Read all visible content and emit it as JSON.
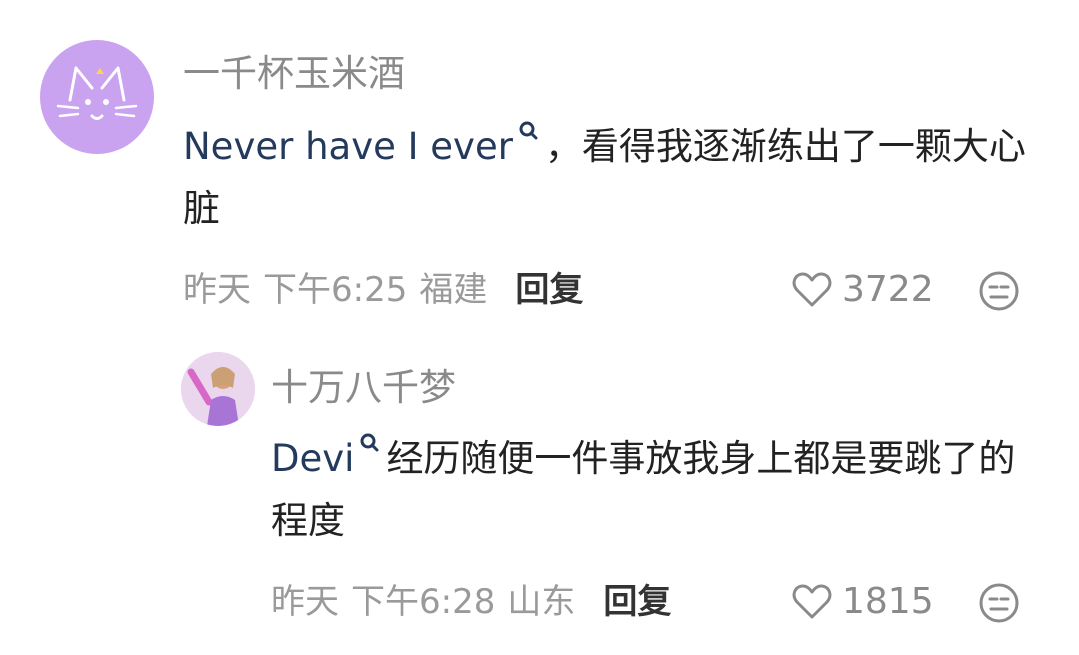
{
  "comments": [
    {
      "username": "一千杯玉米酒",
      "link_text": "Never have I ever",
      "body_after_link": "，看得我逐渐练出了一颗大心脏",
      "date": "昨天",
      "time": "下午6:25",
      "location": "福建",
      "reply_label": "回复",
      "likes": "3722",
      "avatar_color": "#c9a2f0",
      "link_color": "#243a5c"
    },
    {
      "username": "十万八千梦",
      "link_text": "Devi",
      "body_after_link": "经历随便一件事放我身上都是要跳了的程度",
      "date": "昨天",
      "time": "下午6:28",
      "location": "山东",
      "reply_label": "回复",
      "likes": "1815",
      "avatar_color": "#a875d6",
      "link_color": "#243a5c"
    }
  ],
  "icons": {
    "search": "search-icon",
    "like": "heart-outline-icon",
    "dislike": "neutral-face-icon",
    "avatar_main": "cat-face-icon",
    "avatar_reply": "person-photo"
  }
}
